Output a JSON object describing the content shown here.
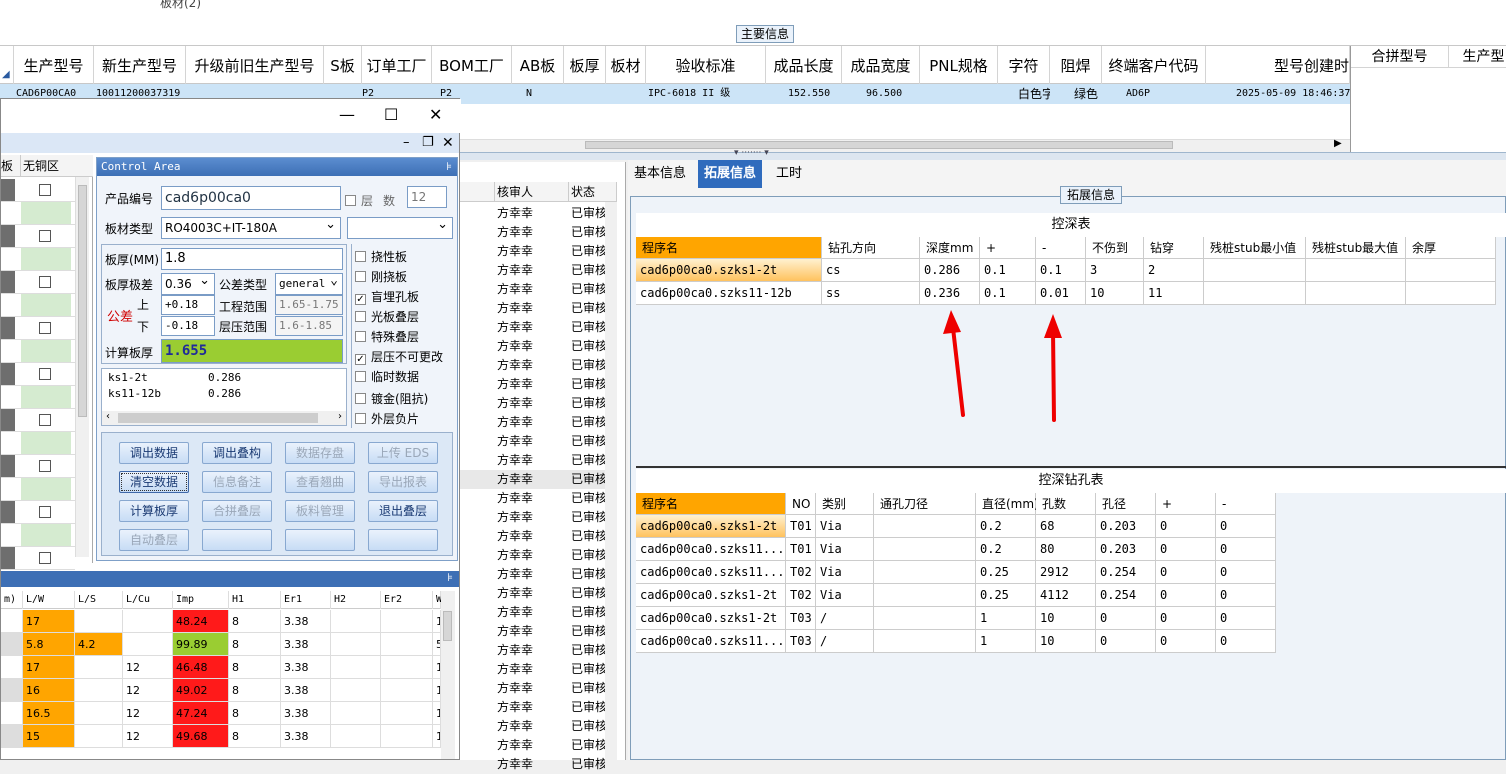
{
  "top": {
    "cut_text": "板材(2)",
    "main_info_label": "主要信息"
  },
  "main_grid": {
    "headers": [
      "生产型号",
      "新生产型号",
      "升级前旧生产型号",
      "S板",
      "订单工厂",
      "BOM工厂",
      "AB板",
      "板厚",
      "板材",
      "验收标准",
      "成品长度",
      "成品宽度",
      "PNL规格",
      "字符",
      "阻焊",
      "终端客户代码",
      "型号创建时"
    ],
    "row": [
      "CAD6P00CA0",
      "10011200037319",
      "",
      "",
      "P2",
      "P2",
      "N",
      "",
      "",
      "IPC-6018 II 级",
      "152.550",
      "96.500",
      "",
      "白色字符",
      "绿色",
      "AD6P",
      "2025-05-09 18:46:37"
    ]
  },
  "right_top": {
    "headers": [
      "合拼型号",
      "生产型"
    ]
  },
  "mid_list": {
    "headers": [
      "核审人",
      "状态"
    ],
    "rows": [
      "方幸幸",
      "方幸幸",
      "方幸幸",
      "方幸幸",
      "方幸幸",
      "方幸幸",
      "方幸幸",
      "方幸幸",
      "方幸幸",
      "方幸幸",
      "方幸幸",
      "方幸幸",
      "方幸幸",
      "方幸幸",
      "方幸幸",
      "方幸幸",
      "方幸幸",
      "方幸幸",
      "方幸幸",
      "方幸幸",
      "方幸幸",
      "方幸幸",
      "方幸幸",
      "方幸幸",
      "方幸幸",
      "方幸幸",
      "方幸幸",
      "方幸幸",
      "方幸幸",
      "方幸幸"
    ],
    "status": "已审核"
  },
  "left_win": {
    "grid_headers": [
      "板",
      "无铜区"
    ],
    "control_area_title": "Control Area",
    "product_no_label": "产品编号",
    "product_no": "cad6p00ca0",
    "layer_label": "层",
    "count_label": "数",
    "count_value": "12",
    "material_label": "板材类型",
    "material_value": "RO4003C+IT-180A",
    "thickness_label": "板厚(MM)",
    "thickness_value": "1.8",
    "tol_level_label": "板厚极差",
    "tol_level_value": "0.36",
    "tol_type_label": "公差类型",
    "tol_type_value": "general",
    "tol_label": "公差",
    "up_label": "上",
    "down_label": "下",
    "up_value": "+0.18",
    "down_value": "-0.18",
    "eng_range_label": "工程范围",
    "eng_range_value": "1.65-1.75",
    "press_range_label": "层压范围",
    "press_range_value": "1.6-1.85",
    "calc_label": "计算板厚",
    "calc_value": "1.655",
    "mini_rows": [
      [
        "ks1-2t",
        "0.286"
      ],
      [
        "ks11-12b",
        "0.286"
      ]
    ],
    "checkboxes": [
      {
        "label": "挠性板",
        "checked": false
      },
      {
        "label": "刚挠板",
        "checked": false
      },
      {
        "label": "盲埋孔板",
        "checked": true
      },
      {
        "label": "光板叠层",
        "checked": false
      },
      {
        "label": "特殊叠层",
        "checked": false
      },
      {
        "label": "层压不可更改",
        "checked": true
      },
      {
        "label": "临时数据",
        "checked": false
      },
      {
        "label": "镀金(阻抗)",
        "checked": false
      },
      {
        "label": "外层负片",
        "checked": false
      }
    ],
    "buttons": [
      [
        "调出数据",
        "调出叠构",
        "数据存盘",
        "上传 EDS"
      ],
      [
        "清空数据",
        "信息备注",
        "查看翘曲",
        "导出报表"
      ],
      [
        "计算板厚",
        "合拼叠层",
        "板料管理",
        "退出叠层"
      ],
      [
        "自动叠层",
        "",
        "",
        ""
      ]
    ],
    "bottom_headers": [
      "m)",
      "L/W",
      "L/S",
      "L/Cu",
      "Imp",
      "H1",
      "Er1",
      "H2",
      "Er2",
      "W"
    ],
    "bottom_rows": [
      [
        "",
        "17",
        "",
        "",
        "48.24",
        "8",
        "3.38",
        "",
        "",
        "1"
      ],
      [
        "",
        "5.8",
        "4.2",
        "",
        "99.89",
        "8",
        "3.38",
        "",
        "",
        "5"
      ],
      [
        "",
        "17",
        "",
        "12",
        "46.48",
        "8",
        "3.38",
        "",
        "",
        "1"
      ],
      [
        "",
        "16",
        "",
        "12",
        "49.02",
        "8",
        "3.38",
        "",
        "",
        "1"
      ],
      [
        "",
        "16.5",
        "",
        "12",
        "47.24",
        "8",
        "3.38",
        "",
        "",
        "1"
      ],
      [
        "",
        "15",
        "",
        "12",
        "49.68",
        "8",
        "3.38",
        "",
        "",
        "1"
      ]
    ]
  },
  "right": {
    "tabs": [
      "基本信息",
      "拓展信息",
      "工时"
    ],
    "ext_label": "拓展信息",
    "t1_title": "控深表",
    "t1_headers": [
      "程序名",
      "钻孔方向",
      "深度mm",
      "+",
      "-",
      "不伤到",
      "钻穿",
      "残桩stub最小值",
      "残桩stub最大值",
      "余厚"
    ],
    "t1_rows": [
      [
        "cad6p00ca0.szks1-2t",
        "cs",
        "0.286",
        "0.1",
        "0.1",
        "3",
        "2",
        "",
        "",
        ""
      ],
      [
        "cad6p00ca0.szks11-12b",
        "ss",
        "0.236",
        "0.1",
        "0.01",
        "10",
        "11",
        "",
        "",
        ""
      ]
    ],
    "t2_title": "控深钻孔表",
    "t2_headers": [
      "程序名",
      "NO",
      "类别",
      "通孔刀径",
      "直径(mm)",
      "孔数",
      "孔径",
      "+",
      "-"
    ],
    "t2_rows": [
      [
        "cad6p00ca0.szks1-2t",
        "T01",
        "Via",
        "",
        "0.2",
        "68",
        "0.203",
        "0",
        "0"
      ],
      [
        "cad6p00ca0.szks11...",
        "T01",
        "Via",
        "",
        "0.2",
        "80",
        "0.203",
        "0",
        "0"
      ],
      [
        "cad6p00ca0.szks11...",
        "T02",
        "Via",
        "",
        "0.25",
        "2912",
        "0.254",
        "0",
        "0"
      ],
      [
        "cad6p00ca0.szks1-2t",
        "T02",
        "Via",
        "",
        "0.25",
        "4112",
        "0.254",
        "0",
        "0"
      ],
      [
        "cad6p00ca0.szks1-2t",
        "T03",
        "/",
        "",
        "1",
        "10",
        "0",
        "0",
        "0"
      ],
      [
        "cad6p00ca0.szks11...",
        "T03",
        "/",
        "",
        "1",
        "10",
        "0",
        "0",
        "0"
      ]
    ]
  },
  "colors": {
    "red": "#ff1a1a",
    "green": "#9acd32",
    "orange": "#ffa500",
    "selection": "#cce4f7",
    "tab_active": "#2f6bbd",
    "arrow": "#ee0000"
  }
}
